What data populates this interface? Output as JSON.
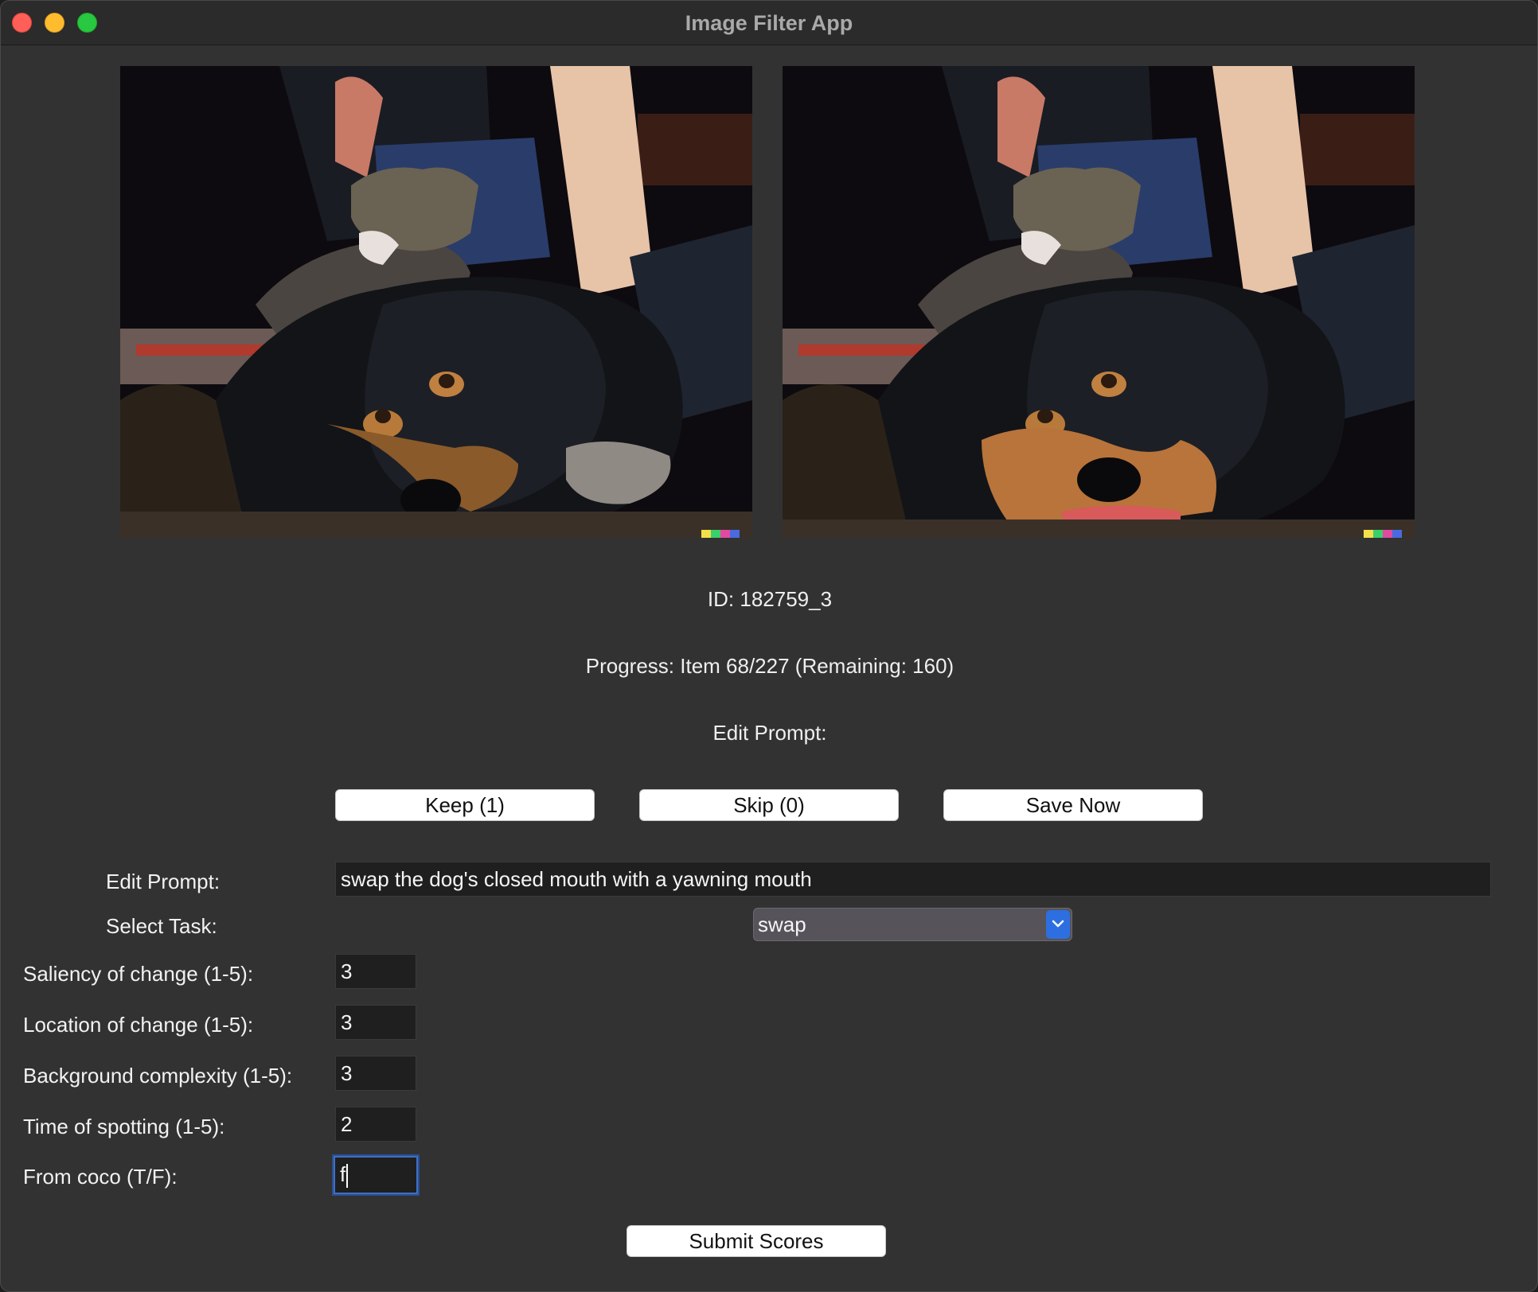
{
  "window": {
    "title": "Image Filter App"
  },
  "info": {
    "id_text": "ID: 182759_3",
    "progress_text": "Progress: Item 68/227 (Remaining: 160)",
    "prompt_caption": "Edit Prompt:"
  },
  "actions": {
    "keep_label": "Keep (1)",
    "skip_label": "Skip (0)",
    "save_label": "Save Now",
    "submit_label": "Submit Scores"
  },
  "form": {
    "edit_prompt_label": "Edit Prompt:",
    "edit_prompt_value": "swap the dog's closed mouth with a yawning mouth",
    "select_task_label": "Select Task:",
    "select_task_value": "swap",
    "saliency_label": "Saliency of change (1-5):",
    "saliency_value": "3",
    "location_label": "Location of change (1-5):",
    "location_value": "3",
    "background_label": "Background complexity (1-5):",
    "background_value": "3",
    "time_label": "Time of spotting (1-5):",
    "time_value": "2",
    "coco_label": "From coco (T/F):",
    "coco_value": "f"
  },
  "images": {
    "left_icon": "dog-and-cat-photo-original",
    "right_icon": "dog-and-cat-photo-edited"
  },
  "colors": {
    "window_bg": "#323232",
    "accent": "#2d6fe0",
    "close": "#ff5f57",
    "minimize": "#febc2e",
    "maximize": "#28c840"
  }
}
